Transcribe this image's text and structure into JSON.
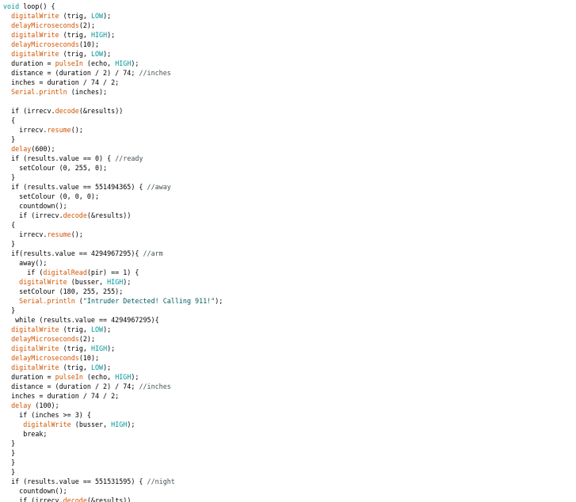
{
  "code_lines": [
    {
      "text": "void loop() {",
      "tokens": [
        {
          "t": "kw",
          "s": "void"
        },
        {
          "t": "plain",
          "s": " loop() {"
        }
      ]
    },
    {
      "text": "  digitalWrite (trig, LOW);",
      "tokens": [
        {
          "t": "plain",
          "s": "  "
        },
        {
          "t": "fn",
          "s": "digitalWrite"
        },
        {
          "t": "plain",
          "s": " (trig, "
        },
        {
          "t": "kw",
          "s": "LOW"
        },
        {
          "t": "plain",
          "s": ");"
        }
      ]
    },
    {
      "text": "  delayMicroseconds(2);",
      "tokens": [
        {
          "t": "plain",
          "s": "  "
        },
        {
          "t": "fn",
          "s": "delayMicroseconds"
        },
        {
          "t": "plain",
          "s": "(2);"
        }
      ]
    },
    {
      "text": "  digitalWrite (trig, HIGH);",
      "tokens": [
        {
          "t": "plain",
          "s": "  "
        },
        {
          "t": "fn",
          "s": "digitalWrite"
        },
        {
          "t": "plain",
          "s": " (trig, "
        },
        {
          "t": "kw",
          "s": "HIGH"
        },
        {
          "t": "plain",
          "s": ");"
        }
      ]
    },
    {
      "text": "  delayMicroseconds(10);",
      "tokens": [
        {
          "t": "plain",
          "s": "  "
        },
        {
          "t": "fn",
          "s": "delayMicroseconds"
        },
        {
          "t": "plain",
          "s": "(10);"
        }
      ]
    },
    {
      "text": "  digitalWrite (trig, LOW);",
      "tokens": [
        {
          "t": "plain",
          "s": "  "
        },
        {
          "t": "fn",
          "s": "digitalWrite"
        },
        {
          "t": "plain",
          "s": " (trig, "
        },
        {
          "t": "kw",
          "s": "LOW"
        },
        {
          "t": "plain",
          "s": ");"
        }
      ]
    },
    {
      "text": "  duration = pulseIn (echo, HIGH);",
      "tokens": [
        {
          "t": "plain",
          "s": "  duration = "
        },
        {
          "t": "fn",
          "s": "pulseIn"
        },
        {
          "t": "plain",
          "s": " (echo, "
        },
        {
          "t": "kw",
          "s": "HIGH"
        },
        {
          "t": "plain",
          "s": ");"
        }
      ]
    },
    {
      "text": "  distance = (duration / 2) / 74; //inches",
      "tokens": [
        {
          "t": "plain",
          "s": "  distance = (duration / 2) / 74; "
        },
        {
          "t": "cmt",
          "s": "//inches"
        }
      ]
    },
    {
      "text": "  inches = duration / 74 / 2;",
      "tokens": [
        {
          "t": "plain",
          "s": "  inches = duration / 74 / 2;"
        }
      ]
    },
    {
      "text": "  Serial.println (inches);",
      "tokens": [
        {
          "t": "plain",
          "s": "  "
        },
        {
          "t": "fn",
          "s": "Serial.println"
        },
        {
          "t": "plain",
          "s": " (inches);"
        }
      ]
    },
    {
      "text": "",
      "tokens": []
    },
    {
      "text": "  if (irrecv.decode(&results))",
      "tokens": [
        {
          "t": "plain",
          "s": "  if (irrecv."
        },
        {
          "t": "fn",
          "s": "decode"
        },
        {
          "t": "plain",
          "s": "(&results))"
        }
      ]
    },
    {
      "text": "  {",
      "tokens": [
        {
          "t": "plain",
          "s": "  {"
        }
      ]
    },
    {
      "text": "    irrecv.resume();",
      "tokens": [
        {
          "t": "plain",
          "s": "    irrecv."
        },
        {
          "t": "fn",
          "s": "resume"
        },
        {
          "t": "plain",
          "s": "();"
        }
      ]
    },
    {
      "text": "  }",
      "tokens": [
        {
          "t": "plain",
          "s": "  }"
        }
      ]
    },
    {
      "text": "  delay(600);",
      "tokens": [
        {
          "t": "plain",
          "s": "  "
        },
        {
          "t": "fn",
          "s": "delay"
        },
        {
          "t": "plain",
          "s": "(600);"
        }
      ]
    },
    {
      "text": "  if (results.value == 0) { //ready",
      "tokens": [
        {
          "t": "plain",
          "s": "  if (results.value == 0) { "
        },
        {
          "t": "cmt",
          "s": "//ready"
        }
      ]
    },
    {
      "text": "    setColour (0, 255, 0);",
      "tokens": [
        {
          "t": "plain",
          "s": "    setColour (0, 255, 0);"
        }
      ]
    },
    {
      "text": "  }",
      "tokens": [
        {
          "t": "plain",
          "s": "  }"
        }
      ]
    },
    {
      "text": "  if (results.value == 551494365) { //away",
      "tokens": [
        {
          "t": "plain",
          "s": "  if (results.value == 551494365) { "
        },
        {
          "t": "cmt",
          "s": "//away"
        }
      ]
    },
    {
      "text": "    setColour (0, 0, 0);",
      "tokens": [
        {
          "t": "plain",
          "s": "    setColour (0, 0, 0);"
        }
      ]
    },
    {
      "text": "    countdown();",
      "tokens": [
        {
          "t": "plain",
          "s": "    countdown();"
        }
      ]
    },
    {
      "text": "    if (irrecv.decode(&results))",
      "tokens": [
        {
          "t": "plain",
          "s": "    if (irrecv."
        },
        {
          "t": "fn",
          "s": "decode"
        },
        {
          "t": "plain",
          "s": "(&results))"
        }
      ]
    },
    {
      "text": "  {",
      "tokens": [
        {
          "t": "plain",
          "s": "  {"
        }
      ]
    },
    {
      "text": "    irrecv.resume();",
      "tokens": [
        {
          "t": "plain",
          "s": "    irrecv."
        },
        {
          "t": "fn",
          "s": "resume"
        },
        {
          "t": "plain",
          "s": "();"
        }
      ]
    },
    {
      "text": "  }",
      "tokens": [
        {
          "t": "plain",
          "s": "  }"
        }
      ]
    },
    {
      "text": "  if(results.value == 4294967295){ //arm",
      "tokens": [
        {
          "t": "plain",
          "s": "  if(results.value == 4294967295){ "
        },
        {
          "t": "cmt",
          "s": "//arm"
        }
      ]
    },
    {
      "text": "    away();",
      "tokens": [
        {
          "t": "plain",
          "s": "    away();"
        }
      ]
    },
    {
      "text": "      if (digitalRead(pir) == 1) {",
      "tokens": [
        {
          "t": "plain",
          "s": "      if ("
        },
        {
          "t": "fn",
          "s": "digitalRead"
        },
        {
          "t": "plain",
          "s": "(pir) == 1) {"
        }
      ]
    },
    {
      "text": "    digitalWrite (busser, HIGH);",
      "tokens": [
        {
          "t": "plain",
          "s": "    "
        },
        {
          "t": "fn",
          "s": "digitalWrite"
        },
        {
          "t": "plain",
          "s": " (busser, "
        },
        {
          "t": "kw",
          "s": "HIGH"
        },
        {
          "t": "plain",
          "s": ");"
        }
      ]
    },
    {
      "text": "    setColour (180, 255, 255);",
      "tokens": [
        {
          "t": "plain",
          "s": "    setColour (180, 255, 255);"
        }
      ]
    },
    {
      "text": "    Serial.println (\"Intruder Detected! Calling 911!\");",
      "tokens": [
        {
          "t": "plain",
          "s": "    "
        },
        {
          "t": "fn",
          "s": "Serial.println"
        },
        {
          "t": "plain",
          "s": " ("
        },
        {
          "t": "str",
          "s": "\"Intruder Detected! Calling 911!\""
        },
        {
          "t": "plain",
          "s": ");"
        }
      ]
    },
    {
      "text": "  }",
      "tokens": [
        {
          "t": "plain",
          "s": "  }"
        }
      ]
    },
    {
      "text": "   while (results.value == 4294967295){",
      "tokens": [
        {
          "t": "plain",
          "s": "   while (results.value == 4294967295){"
        }
      ]
    },
    {
      "text": "  digitalWrite (trig, LOW);",
      "tokens": [
        {
          "t": "plain",
          "s": "  "
        },
        {
          "t": "fn",
          "s": "digitalWrite"
        },
        {
          "t": "plain",
          "s": " (trig, "
        },
        {
          "t": "kw",
          "s": "LOW"
        },
        {
          "t": "plain",
          "s": ");"
        }
      ]
    },
    {
      "text": "  delayMicroseconds(2);",
      "tokens": [
        {
          "t": "plain",
          "s": "  "
        },
        {
          "t": "fn",
          "s": "delayMicroseconds"
        },
        {
          "t": "plain",
          "s": "(2);"
        }
      ]
    },
    {
      "text": "  digitalWrite (trig, HIGH);",
      "tokens": [
        {
          "t": "plain",
          "s": "  "
        },
        {
          "t": "fn",
          "s": "digitalWrite"
        },
        {
          "t": "plain",
          "s": " (trig, "
        },
        {
          "t": "kw",
          "s": "HIGH"
        },
        {
          "t": "plain",
          "s": ");"
        }
      ]
    },
    {
      "text": "  delayMicroseconds(10);",
      "tokens": [
        {
          "t": "plain",
          "s": "  "
        },
        {
          "t": "fn",
          "s": "delayMicroseconds"
        },
        {
          "t": "plain",
          "s": "(10);"
        }
      ]
    },
    {
      "text": "  digitalWrite (trig, LOW);",
      "tokens": [
        {
          "t": "plain",
          "s": "  "
        },
        {
          "t": "fn",
          "s": "digitalWrite"
        },
        {
          "t": "plain",
          "s": " (trig, "
        },
        {
          "t": "kw",
          "s": "LOW"
        },
        {
          "t": "plain",
          "s": ");"
        }
      ]
    },
    {
      "text": "  duration = pulseIn (echo, HIGH);",
      "tokens": [
        {
          "t": "plain",
          "s": "  duration = "
        },
        {
          "t": "fn",
          "s": "pulseIn"
        },
        {
          "t": "plain",
          "s": " (echo, "
        },
        {
          "t": "kw",
          "s": "HIGH"
        },
        {
          "t": "plain",
          "s": ");"
        }
      ]
    },
    {
      "text": "  distance = (duration / 2) / 74; //inches",
      "tokens": [
        {
          "t": "plain",
          "s": "  distance = (duration / 2) / 74; "
        },
        {
          "t": "cmt",
          "s": "//inches"
        }
      ]
    },
    {
      "text": "  inches = duration / 74 / 2;",
      "tokens": [
        {
          "t": "plain",
          "s": "  inches = duration / 74 / 2;"
        }
      ]
    },
    {
      "text": "  delay (100);",
      "tokens": [
        {
          "t": "plain",
          "s": "  "
        },
        {
          "t": "fn",
          "s": "delay"
        },
        {
          "t": "plain",
          "s": " (100);"
        }
      ]
    },
    {
      "text": "    if (inches >= 3) {",
      "tokens": [
        {
          "t": "plain",
          "s": "    if (inches >= 3) {"
        }
      ]
    },
    {
      "text": "     digitalWrite (busser, HIGH);",
      "tokens": [
        {
          "t": "plain",
          "s": "     "
        },
        {
          "t": "fn",
          "s": "digitalWrite"
        },
        {
          "t": "plain",
          "s": " (busser, "
        },
        {
          "t": "kw",
          "s": "HIGH"
        },
        {
          "t": "plain",
          "s": ");"
        }
      ]
    },
    {
      "text": "     break;",
      "tokens": [
        {
          "t": "plain",
          "s": "     break;"
        }
      ]
    },
    {
      "text": "  }",
      "tokens": [
        {
          "t": "plain",
          "s": "  }"
        }
      ]
    },
    {
      "text": "  }",
      "tokens": [
        {
          "t": "plain",
          "s": "  }"
        }
      ]
    },
    {
      "text": "  }",
      "tokens": [
        {
          "t": "plain",
          "s": "  }"
        }
      ]
    },
    {
      "text": "  }",
      "tokens": [
        {
          "t": "plain",
          "s": "  }"
        }
      ]
    },
    {
      "text": "  if (results.value == 551531595) { //night",
      "tokens": [
        {
          "t": "plain",
          "s": "  if (results.value == 551531595) { "
        },
        {
          "t": "cmt",
          "s": "//night"
        }
      ]
    },
    {
      "text": "    countdown();",
      "tokens": [
        {
          "t": "plain",
          "s": "    countdown();"
        }
      ]
    },
    {
      "text": "    if (irrecv.decode(&results))",
      "tokens": [
        {
          "t": "plain",
          "s": "    if (irrecv."
        },
        {
          "t": "fn",
          "s": "decode"
        },
        {
          "t": "plain",
          "s": "(&results))"
        }
      ]
    }
  ],
  "colors": {
    "keyword": "#00979c",
    "function": "#d35400",
    "string": "#005c5f",
    "comment": "#434f54",
    "text": "#000000",
    "background": "#ffffff"
  }
}
